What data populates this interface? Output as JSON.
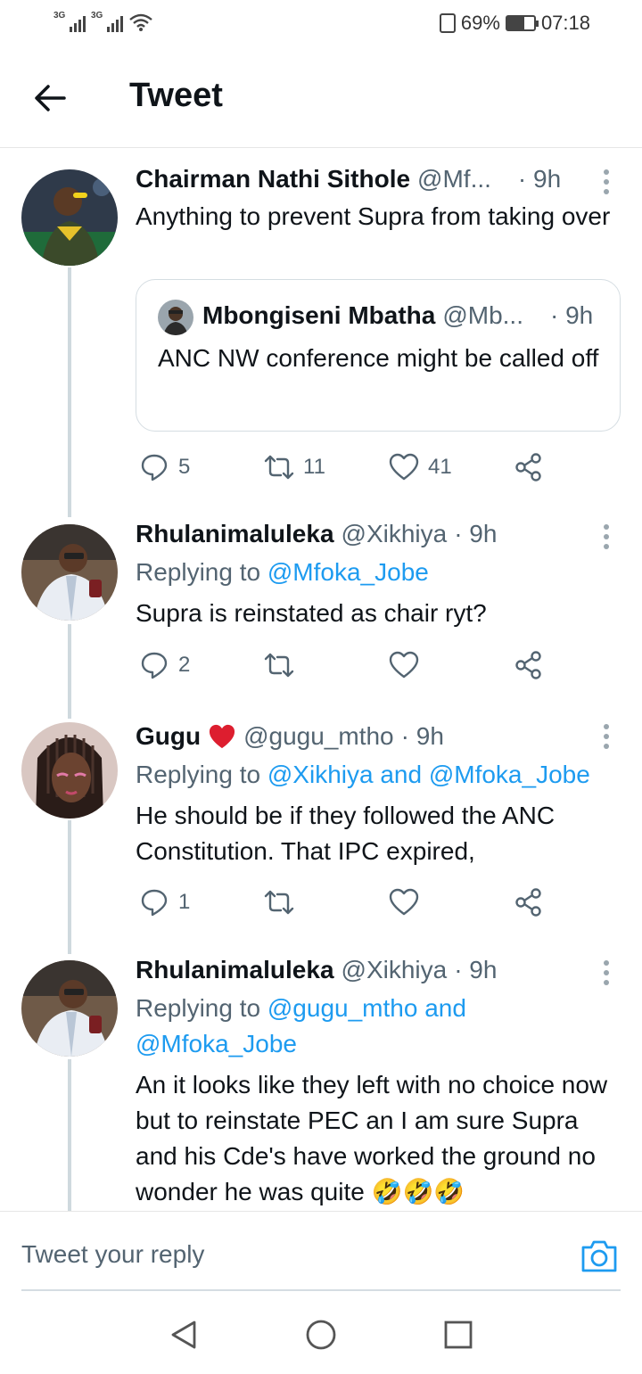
{
  "status_bar": {
    "network1": "3G",
    "network2": "3G",
    "battery": "69%",
    "time": "07:18"
  },
  "header": {
    "title": "Tweet",
    "back_icon": "arrow-left-icon"
  },
  "tweets": [
    {
      "name": "Chairman Nathi Sithole",
      "handle": "@Mf...",
      "time": "· 9h",
      "text": "Anything to prevent Supra from taking over",
      "quote": {
        "name": "Mbongiseni Mbatha",
        "handle": "@Mb...",
        "time": "· 9h",
        "text": "ANC NW conference might be called off"
      },
      "replies": "5",
      "retweets": "11",
      "likes": "41"
    },
    {
      "name": "Rhulanimaluleka",
      "handle": "@Xikhiya",
      "time": "· 9h",
      "replying_prefix": "Replying to",
      "replying_to": "@Mfoka_Jobe",
      "text": "Supra is reinstated as chair ryt?",
      "replies": "2",
      "retweets": "",
      "likes": ""
    },
    {
      "name": "Gugu",
      "name_emoji": "❤️",
      "handle": "@gugu_mtho",
      "time": "· 9h",
      "replying_prefix": "Replying to",
      "replying_to": "@Xikhiya and @Mfoka_Jobe",
      "text": "He should be if they followed the ANC Constitution. That IPC expired,",
      "replies": "1",
      "retweets": "",
      "likes": ""
    },
    {
      "name": "Rhulanimaluleka",
      "handle": "@Xikhiya",
      "time": "· 9h",
      "replying_prefix": "Replying to",
      "replying_to": "@gugu_mtho and @Mfoka_Jobe",
      "text": "An it looks like they left with no choice now but to reinstate PEC an I am sure Supra and his Cde's have worked the ground no wonder he was quite 🤣🤣🤣"
    }
  ],
  "reply_bar": {
    "placeholder": "Tweet your reply",
    "camera_icon": "camera-icon"
  },
  "nav_bar": {
    "back": "nav-back-icon",
    "home": "nav-home-icon",
    "recents": "nav-recents-icon"
  },
  "colors": {
    "link": "#1d9bf0",
    "secondary_text": "#536471",
    "thread_line": "#cfd9de",
    "heart": "#e0245e"
  }
}
